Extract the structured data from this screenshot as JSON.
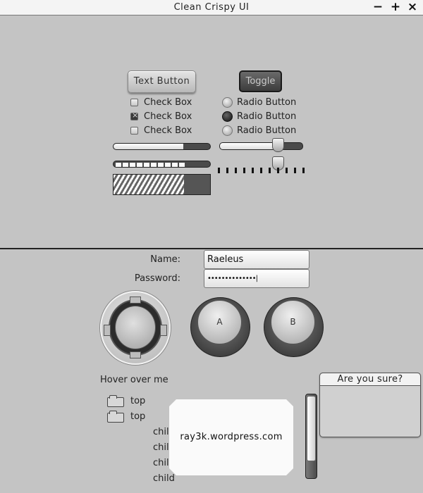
{
  "window": {
    "title": "Clean Crispy UI",
    "controls": [
      "−",
      "+",
      "×"
    ]
  },
  "top_panel": {
    "text_button": "Text Button",
    "toggle_button": "Toggle",
    "checkboxes": [
      {
        "label": "Check Box",
        "checked": false
      },
      {
        "label": "Check Box",
        "checked": true
      },
      {
        "label": "Check Box",
        "checked": false
      }
    ],
    "radios": [
      {
        "label": "Radio Button",
        "checked": false
      },
      {
        "label": "Radio Button",
        "checked": true
      },
      {
        "label": "Radio Button",
        "checked": false
      }
    ],
    "progress_bar_value": 0.72,
    "segmented_progress_value": 0.72,
    "striped_progress_value": 0.73,
    "horizontal_slider_value": 0.7,
    "ticked_slider_value": 0.7
  },
  "bottom_panel": {
    "form": {
      "name_label": "Name:",
      "name_value": "Raeleus",
      "password_label": "Password:",
      "password_value": "••••••••••••••|"
    },
    "round_buttons": {
      "a_label": "A",
      "b_label": "B"
    },
    "hover_label": "Hover over me",
    "tree": [
      {
        "label": "top",
        "expanded": false
      },
      {
        "label": "top",
        "expanded": true
      },
      {
        "label": "child"
      },
      {
        "label": "child"
      },
      {
        "label": "child"
      },
      {
        "label": "child"
      }
    ],
    "tooltip_text": "ray3k.wordpress.com",
    "dialog_title": "Are you sure?",
    "scroll_value": 0.0
  }
}
